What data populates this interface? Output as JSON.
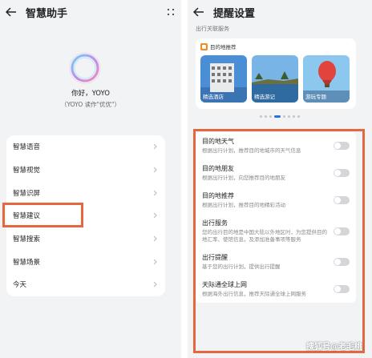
{
  "left": {
    "header": {
      "title": "智慧助手",
      "back_icon": "back-arrow-icon",
      "more_icon": "grid-dots-icon"
    },
    "assistant": {
      "greeting": "你好，YOYO",
      "note": "（YOYO 读作\"优优\"）"
    },
    "menu": [
      {
        "label": "智慧语音"
      },
      {
        "label": "智慧视觉"
      },
      {
        "label": "智慧识屏"
      },
      {
        "label": "智慧建议"
      },
      {
        "label": "智慧搜索"
      },
      {
        "label": "智慧场景"
      },
      {
        "label": "今天"
      }
    ],
    "highlighted_item": "智慧建议"
  },
  "right": {
    "header": {
      "title": "提醒设置",
      "back_icon": "back-arrow-icon"
    },
    "section_label": "出行关联服务",
    "recommendation": {
      "title": "目的地推荐",
      "thumbs": [
        {
          "caption": "精选酒店"
        },
        {
          "caption": "精选游记"
        },
        {
          "caption": "游玩专题"
        }
      ],
      "page_count": 8,
      "active_page": 3
    },
    "settings": [
      {
        "title": "目的地天气",
        "desc": "根据出行计划，推荐目的地城市的天气信息",
        "enabled": false
      },
      {
        "title": "目的地朋友",
        "desc": "根据出行计划，向您推荐目的地朋友",
        "enabled": false
      },
      {
        "title": "目的地推荐",
        "desc": "根据出行计划，推荐目的地精彩活动",
        "enabled": false
      },
      {
        "title": "出行服务",
        "desc": "您的出行目的地是中国大陆以外地区时，为您提供目的地汇率、使馆信息，及添加准备事项等服务",
        "enabled": false
      },
      {
        "title": "出行提醒",
        "desc": "基于您的出行计划，提供出行提醒",
        "enabled": false
      },
      {
        "title": "天际通全球上网",
        "desc": "根据海外出行信息，推荐天际通全球上网服务",
        "enabled": false
      }
    ]
  },
  "watermark": "搜狐号@老毛桃",
  "colors": {
    "highlight": "#e4673f",
    "accent": "#2c6ee6",
    "background": "#f1f3f5"
  }
}
